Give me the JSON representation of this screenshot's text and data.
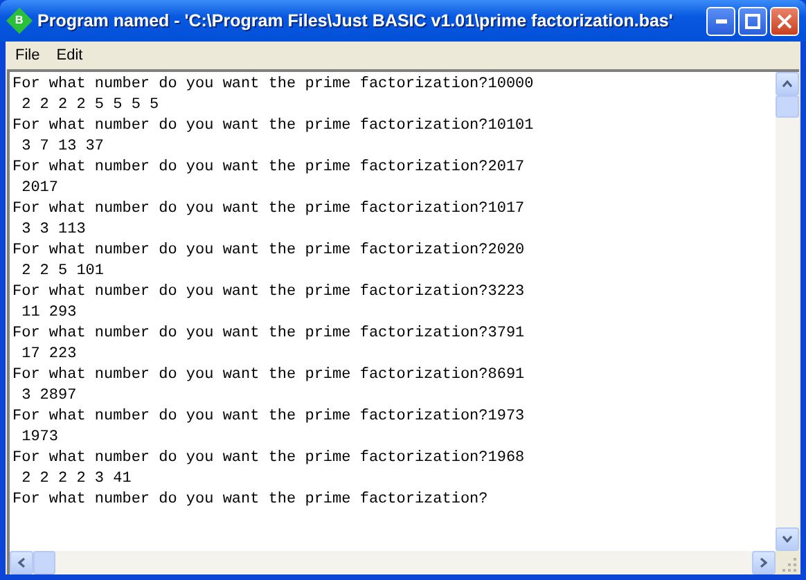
{
  "window": {
    "title": "Program named - 'C:\\Program Files\\Just BASIC v1.01\\prime factorization.bas'",
    "app_icon_letter": "B"
  },
  "menu": [
    "File",
    "Edit"
  ],
  "output": {
    "lines": [
      "For what number do you want the prime factorization?10000",
      " 2 2 2 2 5 5 5 5",
      "For what number do you want the prime factorization?10101",
      " 3 7 13 37",
      "For what number do you want the prime factorization?2017",
      " 2017",
      "For what number do you want the prime factorization?1017",
      " 3 3 113",
      "For what number do you want the prime factorization?2020",
      " 2 2 5 101",
      "For what number do you want the prime factorization?3223",
      " 11 293",
      "For what number do you want the prime factorization?3791",
      " 17 223",
      "For what number do you want the prime factorization?8691",
      " 3 2897",
      "For what number do you want the prime factorization?1973",
      " 1973",
      "For what number do you want the prime factorization?1968",
      " 2 2 2 2 3 41",
      "For what number do you want the prime factorization?"
    ]
  }
}
